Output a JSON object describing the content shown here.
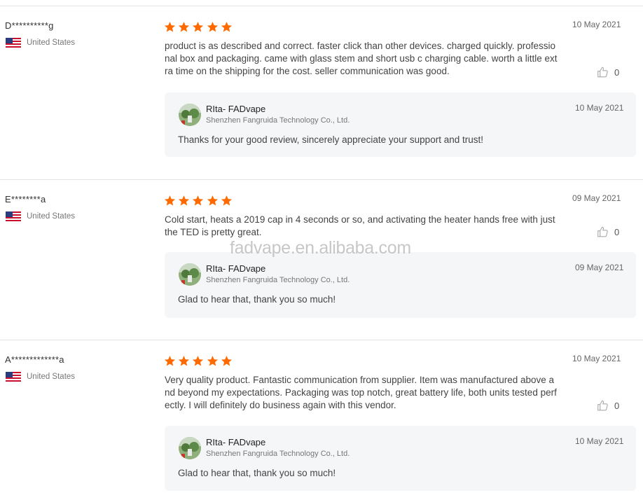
{
  "reviews": [
    {
      "user": "D**********g",
      "country": "United States",
      "rating": 5,
      "date": "10 May 2021",
      "text": "product is as described and correct. faster click than other devices. charged quickly. professional box and packaging. came with glass stem and short usb c charging cable. worth a little extra time on the shipping for the cost. seller communication was good.",
      "likes": "0",
      "reply": {
        "seller": "RIta- FADvape",
        "company": "Shenzhen Fangruida Technology Co., Ltd.",
        "date": "10 May 2021",
        "text": "Thanks for your good review, sincerely appreciate your support and trust!"
      }
    },
    {
      "user": "E********a",
      "country": "United States",
      "rating": 5,
      "date": "09 May 2021",
      "text": "Cold start, heats a 2019 cap in 4 seconds or so, and activating the heater hands free with just the TED is pretty great.",
      "likes": "0",
      "reply": {
        "seller": "RIta- FADvape",
        "company": "Shenzhen Fangruida Technology Co., Ltd.",
        "date": "09 May 2021",
        "text": "Glad to hear that, thank you so much!"
      }
    },
    {
      "user": "A*************a",
      "country": "United States",
      "rating": 5,
      "date": "10 May 2021",
      "text": "Very quality product.  Fantastic communication from supplier.  Item was manufactured above and beyond my expectations.   Packaging was top notch, great battery life, both units tested perfectly. I will definitely do business again with this vendor.",
      "likes": "0",
      "reply": {
        "seller": "RIta- FADvape",
        "company": "Shenzhen Fangruida Technology Co., Ltd.",
        "date": "10 May 2021",
        "text": "Glad to hear that, thank you so much!"
      }
    }
  ],
  "watermark": "fadvape.en.alibaba.com",
  "colors": {
    "star": "#ff6a00",
    "reply_bg": "#f5f6f8",
    "divider": "#e3e3e3"
  },
  "icons": {
    "flag": "us-flag-icon",
    "like": "thumbs-up-icon",
    "star": "star-icon"
  }
}
